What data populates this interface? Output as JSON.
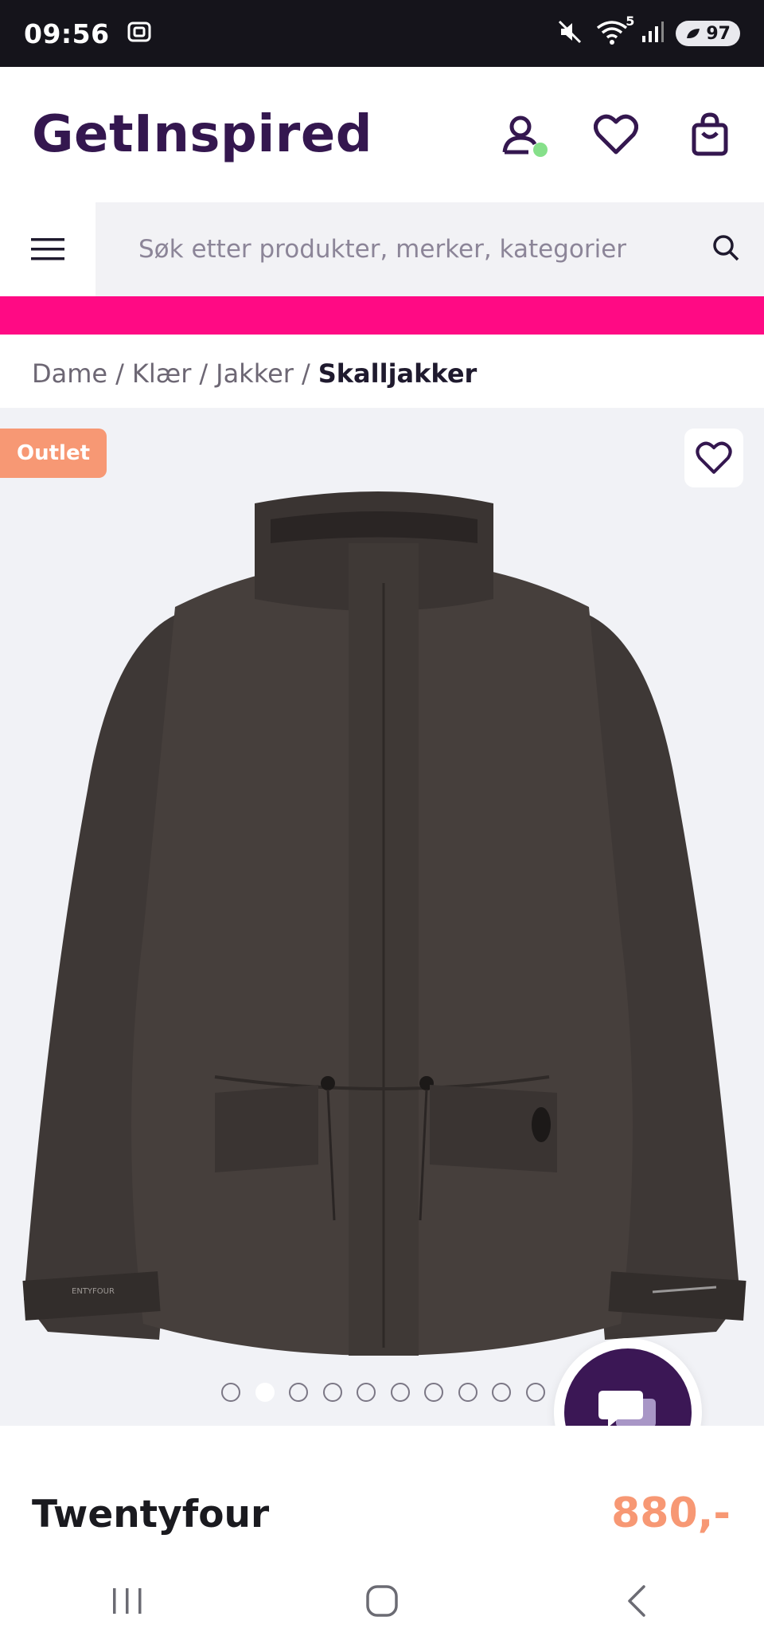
{
  "status_bar": {
    "time": "09:56",
    "battery": "97",
    "network_label": "5"
  },
  "header": {
    "logo": "GetInspired",
    "icons": [
      "user-icon",
      "heart-icon",
      "shopping-bag-icon"
    ],
    "accent_color": "#34174f"
  },
  "search": {
    "placeholder": "Søk etter produkter, merker, kategorier"
  },
  "promo": {
    "color": "#ff0a84"
  },
  "breadcrumb": {
    "items": [
      "Dame",
      "Klær",
      "Jakker"
    ],
    "current": "Skalljakker",
    "separator": "/"
  },
  "product": {
    "badge": "Outlet",
    "brand": "Twentyfour",
    "price": "880,-",
    "price_color": "#f79874",
    "image_count": 10,
    "active_image_index": 1,
    "jacket_label": "ENTYFOUR"
  },
  "chat": {
    "icon": "chat-bubbles-icon"
  },
  "navbar": {
    "icons": [
      "recent-apps-icon",
      "home-icon",
      "back-icon"
    ]
  }
}
